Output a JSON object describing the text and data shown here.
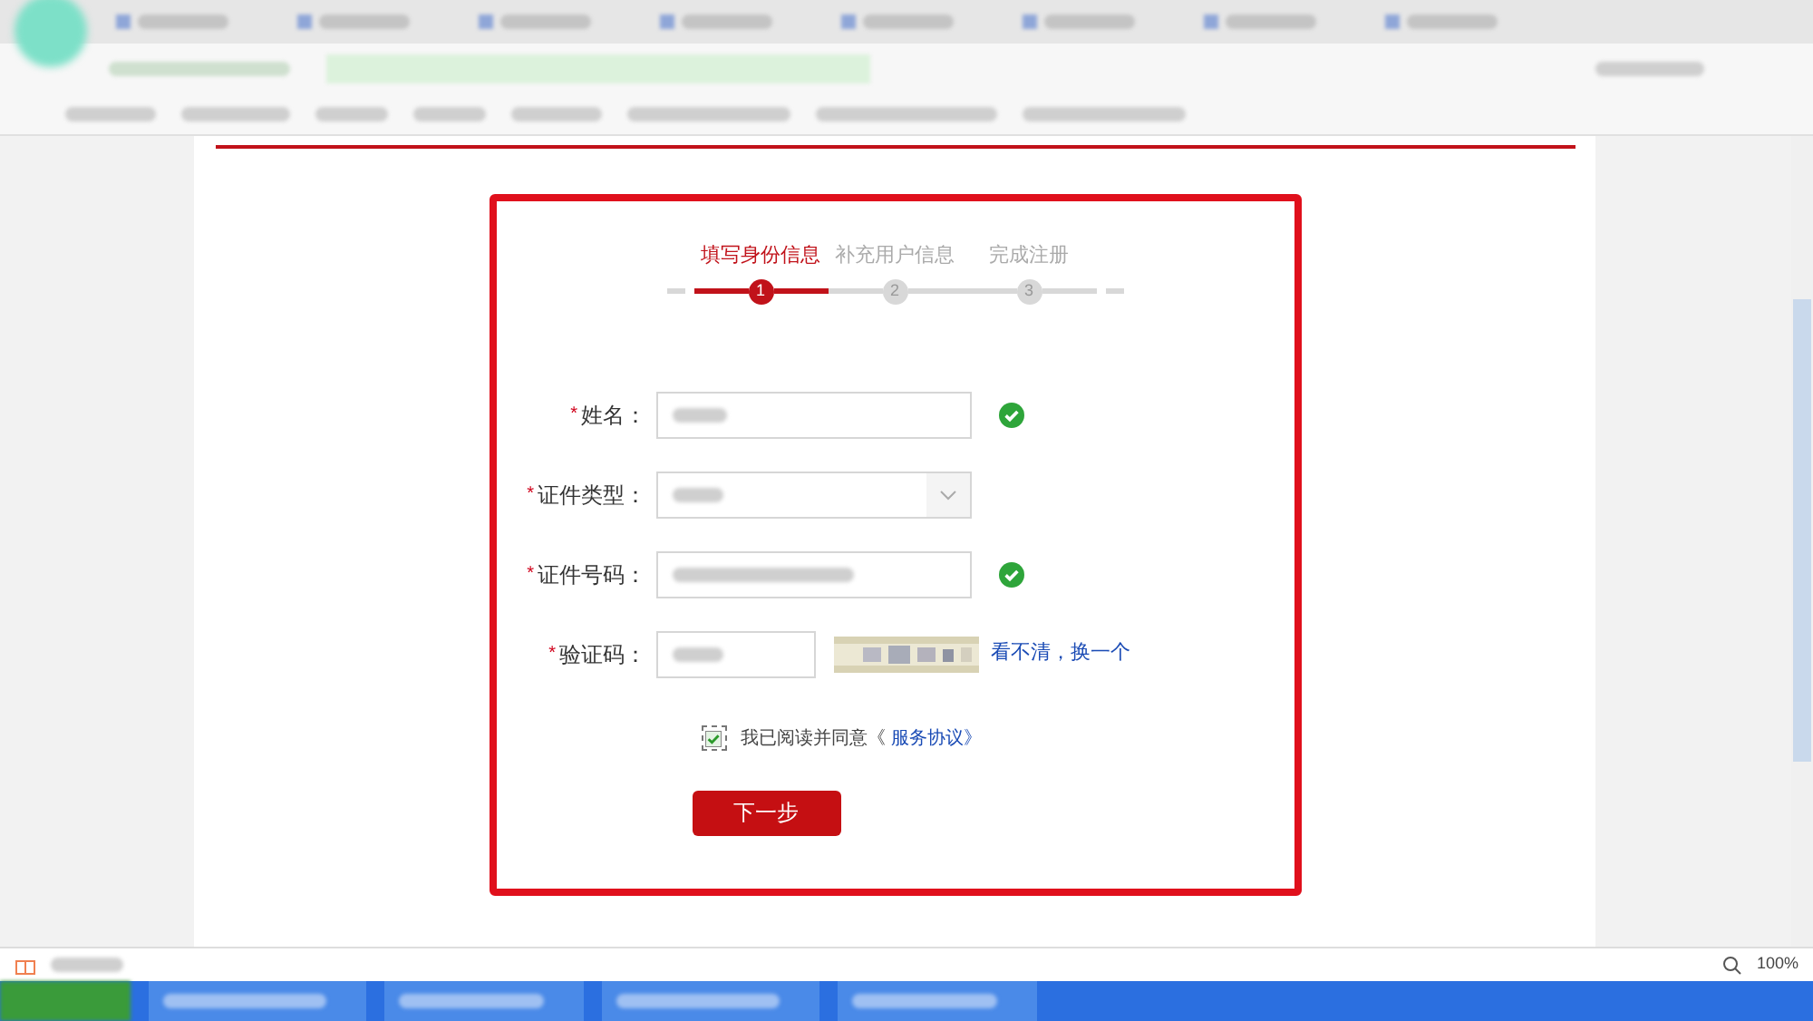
{
  "steps": [
    {
      "label": "填写身份信息",
      "number": "1",
      "selected": true
    },
    {
      "label": "补充用户信息",
      "number": "2",
      "selected": false
    },
    {
      "label": "完成注册",
      "number": "3",
      "selected": false
    }
  ],
  "fields": [
    {
      "required_mark": "*",
      "label": "姓名：",
      "kind": "text",
      "valid": true
    },
    {
      "required_mark": "*",
      "label": "证件类型：",
      "kind": "select",
      "valid": false
    },
    {
      "required_mark": "*",
      "label": "证件号码：",
      "kind": "text",
      "valid": true
    },
    {
      "required_mark": "*",
      "label": "验证码：",
      "kind": "captcha",
      "valid": false,
      "refresh_link": "看不清，换一个"
    }
  ],
  "agreement": {
    "checked": true,
    "text": "我已阅读并同意《",
    "link": "服务协议》"
  },
  "submit": "下一步",
  "status_bar": {
    "zoom": "100%"
  }
}
